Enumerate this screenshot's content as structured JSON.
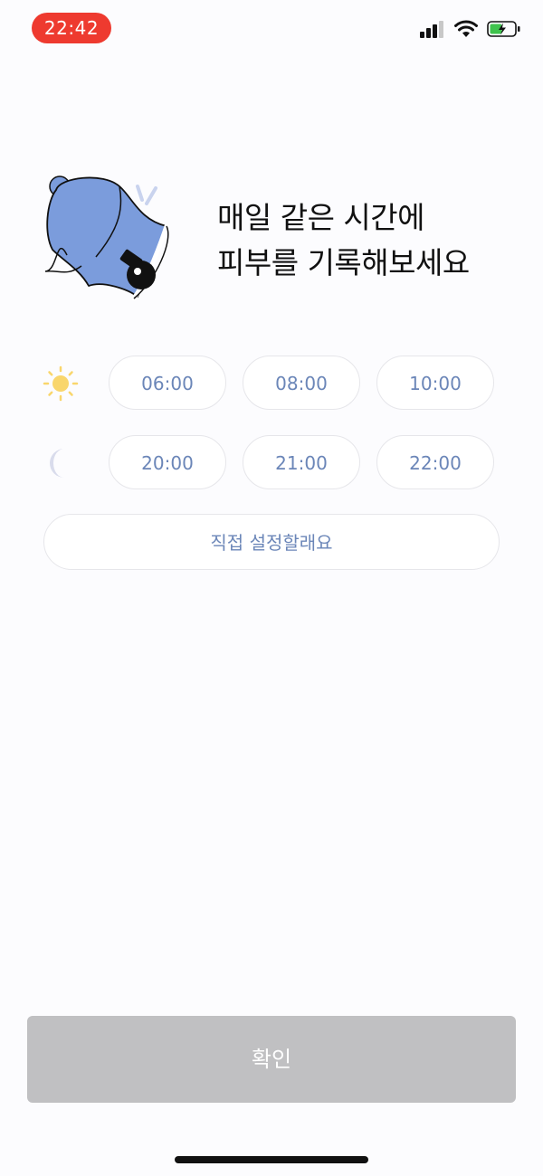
{
  "status_bar": {
    "time": "22:42",
    "icons": [
      "cellular-signal-icon",
      "wifi-icon",
      "battery-charging-icon"
    ]
  },
  "hero": {
    "illustration": "bell-icon",
    "title_line1": "매일 같은 시간에",
    "title_line2": "피부를 기록해보세요"
  },
  "morning": {
    "icon": "sun-icon",
    "times": [
      "06:00",
      "08:00",
      "10:00"
    ]
  },
  "evening": {
    "icon": "moon-icon",
    "times": [
      "20:00",
      "21:00",
      "22:00"
    ]
  },
  "custom_option": {
    "label": "직접 설정할래요"
  },
  "confirm": {
    "label": "확인",
    "enabled": false
  },
  "colors": {
    "accent_text": "#6b86b8",
    "bell_blue": "#7b9cdc",
    "sun_yellow": "#f9d66c",
    "moon_lavender": "#d9dcec",
    "button_disabled": "#c0c0c2",
    "time_pill": "#ee3a2f"
  }
}
